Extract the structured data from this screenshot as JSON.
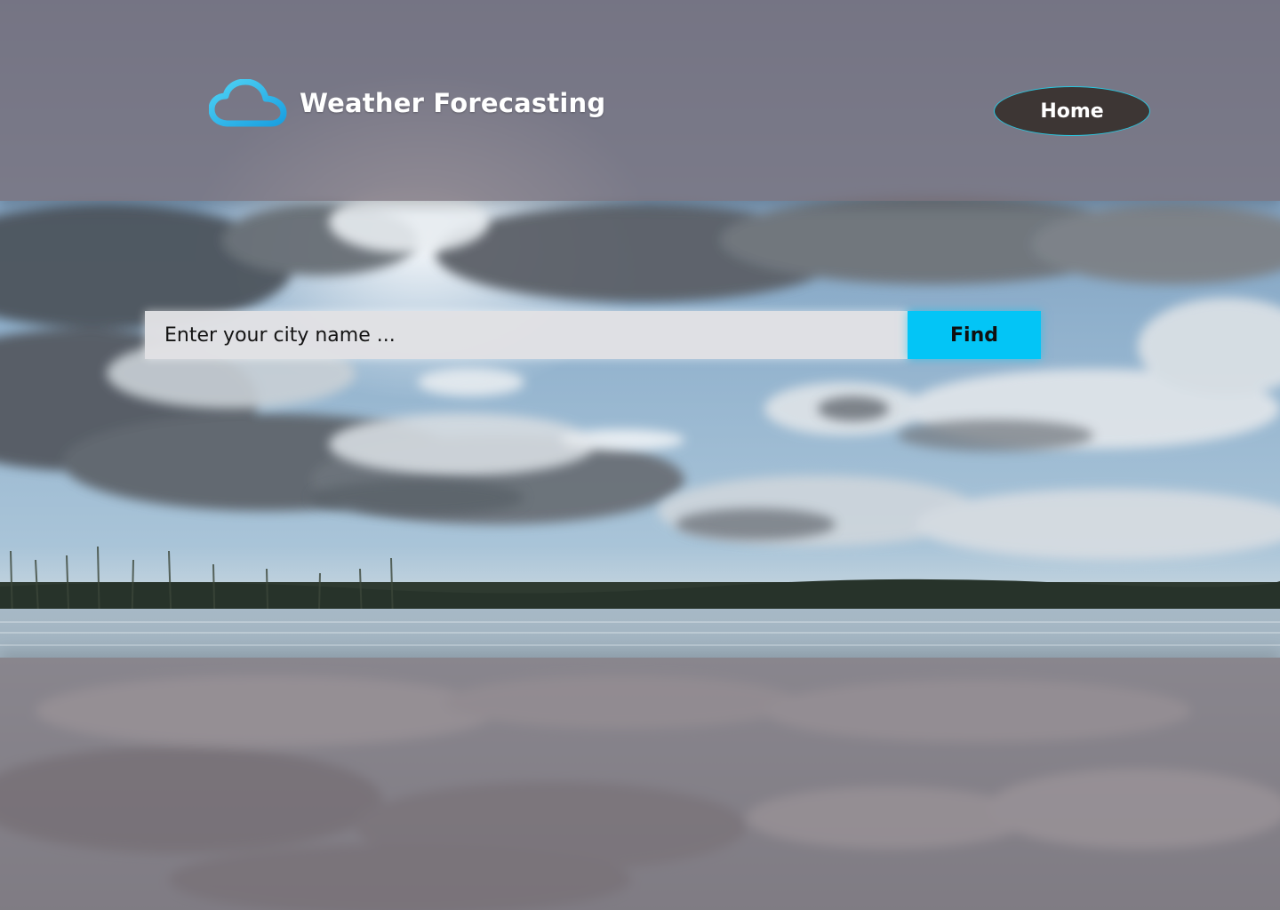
{
  "header": {
    "logo_icon": "cloud-icon",
    "title": "Weather Forecasting",
    "nav": {
      "home_label": "Home"
    }
  },
  "search": {
    "placeholder": "Enter your city name ...",
    "value": "",
    "find_label": "Find"
  },
  "colors": {
    "accent": "#03c5f6",
    "home_button_bg": "#3d3634",
    "home_button_border": "#29c7e0",
    "header_overlay": "#78707a"
  }
}
